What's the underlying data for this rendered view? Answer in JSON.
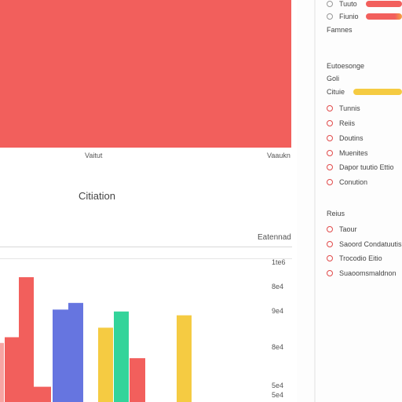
{
  "main": {
    "hero": {
      "color": "#f25f5c",
      "label_left": "Vaitut",
      "label_right": "Vaaukn"
    },
    "section_title": "Citiation",
    "chart_label": "Eatennad"
  },
  "chart_data": {
    "type": "bar",
    "title": "",
    "xlabel": "",
    "ylabel": "",
    "ytick_labels": [
      "1te6",
      "8e4",
      "9e4",
      "8e4",
      "5e4",
      "5e4"
    ],
    "bars": [
      {
        "value": 68,
        "color": "#f25f5c"
      },
      {
        "value": 131,
        "color": "#f25f5c"
      },
      {
        "value": 16,
        "color": "#f25f5c"
      },
      {
        "value": 97,
        "color": "#6675e0"
      },
      {
        "value": 104,
        "color": "#6675e0"
      },
      {
        "value": 78,
        "color": "#f5cb42"
      },
      {
        "value": 95,
        "color": "#33d49a"
      },
      {
        "value": 46,
        "color": "#f25f5c"
      },
      {
        "value": 91,
        "color": "#f5cb42"
      }
    ],
    "ylim": [
      0,
      150
    ]
  },
  "sidebar": {
    "top_items": [
      {
        "label": "Tuuto",
        "bar_color": "#f25f5c",
        "bar_fill": 0.95
      },
      {
        "label": "Fiunio",
        "bar_color": "#f25f5c",
        "bar_fill": 0.95
      }
    ],
    "group1_label": "Famnes",
    "heading2": "Eutoesonge",
    "heading3": "Goli",
    "progress_item": {
      "label": "Cituie",
      "color": "#f5cb42",
      "fill": 1.0
    },
    "items": [
      {
        "label": "Tunnis"
      },
      {
        "label": "Reiis"
      },
      {
        "label": "Doutins"
      },
      {
        "label": "Muenites"
      },
      {
        "label": "Dapor tuutio Ettio"
      },
      {
        "label": "Conution"
      }
    ],
    "heading4": "Reius",
    "items2": [
      {
        "label": "Taour"
      },
      {
        "label": "Saoord Condatuutis"
      },
      {
        "label": "Trocodio Eitio"
      },
      {
        "label": "Suaoomsmaldnon"
      }
    ]
  }
}
